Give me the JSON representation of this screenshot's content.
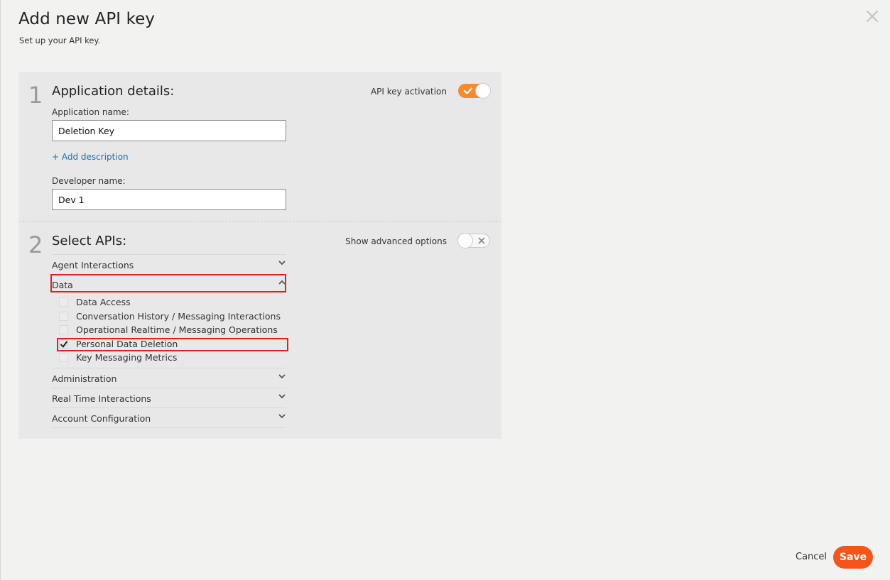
{
  "header": {
    "title": "Add new API key",
    "subtitle": "Set up your API key."
  },
  "step1": {
    "number": "1",
    "title": "Application details:",
    "activation_label": "API key activation",
    "activation_on": true,
    "app_name_label": "Application name:",
    "app_name_value": "Deletion Key",
    "add_description_link": "+ Add description",
    "developer_label": "Developer name:",
    "developer_value": "Dev 1"
  },
  "step2": {
    "number": "2",
    "title": "Select APIs:",
    "advanced_label": "Show advanced options",
    "advanced_on": false,
    "groups": [
      {
        "label": "Agent Interactions",
        "expanded": false
      },
      {
        "label": "Data",
        "expanded": true
      },
      {
        "label": "Administration",
        "expanded": false
      },
      {
        "label": "Real Time Interactions",
        "expanded": false
      },
      {
        "label": "Account Configuration",
        "expanded": false
      }
    ],
    "data_items": [
      {
        "label": "Data Access",
        "checked": false
      },
      {
        "label": "Conversation History / Messaging Interactions",
        "checked": false
      },
      {
        "label": "Operational Realtime / Messaging Operations",
        "checked": false
      },
      {
        "label": "Personal Data Deletion",
        "checked": true
      },
      {
        "label": "Key Messaging Metrics",
        "checked": false
      }
    ]
  },
  "footer": {
    "cancel_label": "Cancel",
    "save_label": "Save"
  },
  "colors": {
    "accent_orange": "#f68a2e",
    "save_button": "#f5541a",
    "link_blue": "#1c6fa8",
    "highlight_red": "#e02020"
  }
}
